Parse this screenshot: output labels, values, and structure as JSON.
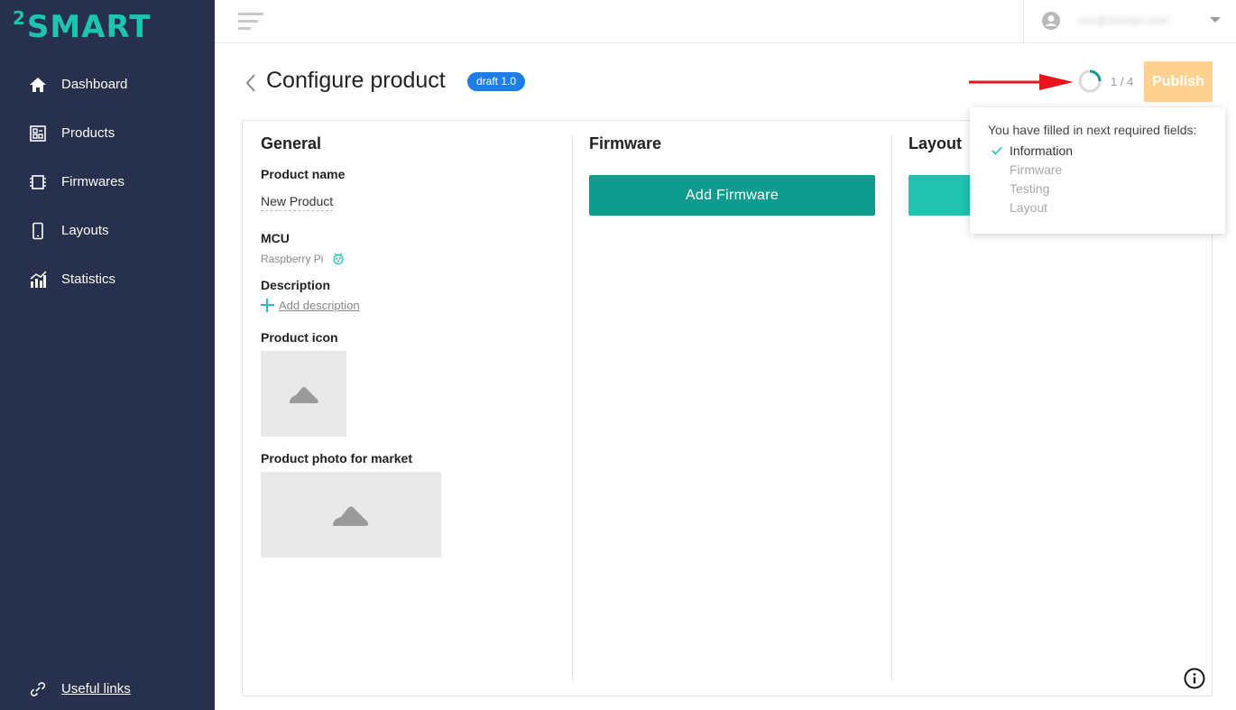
{
  "sidebar": {
    "logo_sup": "2",
    "logo_text": "SMART",
    "items": [
      {
        "label": "Dashboard",
        "icon": "home-icon"
      },
      {
        "label": "Products",
        "icon": "products-icon"
      },
      {
        "label": "Firmwares",
        "icon": "chip-icon"
      },
      {
        "label": "Layouts",
        "icon": "phone-icon"
      },
      {
        "label": "Statistics",
        "icon": "statistics-icon"
      }
    ],
    "useful_links": "Useful links"
  },
  "topbar": {
    "user_email": "ccc@2smart.com"
  },
  "header": {
    "title": "Configure product",
    "badge": "draft 1.0",
    "progress_text": "1 / 4",
    "progress_fraction": 0.25,
    "publish_label": "Publish"
  },
  "general": {
    "title": "General",
    "product_name_label": "Product name",
    "product_name_value": "New Product",
    "mcu_label": "MCU",
    "mcu_value": "Raspberry Pi",
    "description_label": "Description",
    "add_description": "Add description",
    "icon_label": "Product icon",
    "photo_label": "Product photo for market"
  },
  "firmware": {
    "title": "Firmware",
    "add_button": "Add Firmware"
  },
  "layout": {
    "title": "Layout"
  },
  "popover": {
    "heading": "You have filled in next required fields:",
    "fields": [
      {
        "label": "Information",
        "filled": true
      },
      {
        "label": "Firmware",
        "filled": false
      },
      {
        "label": "Testing",
        "filled": false
      },
      {
        "label": "Layout",
        "filled": false
      }
    ]
  },
  "colors": {
    "sidebar_bg": "#27304d",
    "accent": "#1fc3b0",
    "firmware_button": "#0f9b8e",
    "badge": "#1e7ee6",
    "publish_disabled": "#fdd190",
    "annotation_arrow": "#e8141b"
  }
}
